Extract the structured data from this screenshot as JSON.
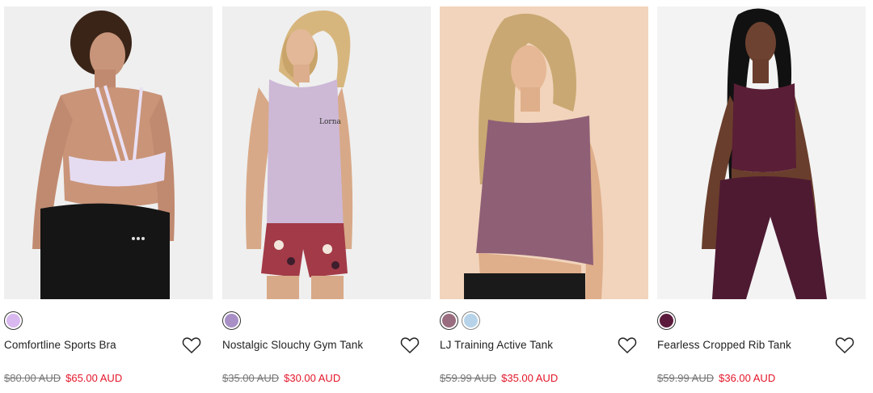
{
  "products": [
    {
      "name": "Comfortline Sports Bra",
      "was_price": "$80.00 AUD",
      "price": "$65.00 AUD",
      "swatches": [
        "#d8b8ee"
      ],
      "background": "#efefef"
    },
    {
      "name": "Nostalgic Slouchy Gym Tank",
      "was_price": "$35.00 AUD",
      "price": "$30.00 AUD",
      "swatches": [
        "#a88fc6"
      ],
      "background": "#efefef"
    },
    {
      "name": "LJ Training Active Tank",
      "was_price": "$59.99 AUD",
      "price": "$35.00 AUD",
      "swatches": [
        "#9a6c7f",
        "#b6d3ea"
      ],
      "background": "#f1d4bb"
    },
    {
      "name": "Fearless Cropped Rib Tank",
      "was_price": "$59.99 AUD",
      "price": "$36.00 AUD",
      "swatches": [
        "#5b1a3c"
      ],
      "background": "#f3f3f3"
    }
  ],
  "icons": {
    "wishlist": "heart-outline-icon"
  },
  "colors": {
    "sale_price": "#e3162a",
    "was_price": "#777777"
  }
}
